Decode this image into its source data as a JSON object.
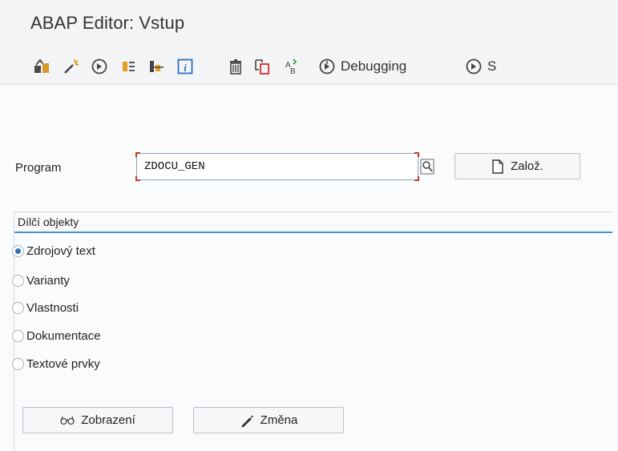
{
  "window": {
    "title": "ABAP Editor: Vstup"
  },
  "toolbar": {
    "icons": [
      "object-list-icon",
      "magic-wand-icon",
      "execute-icon",
      "where-used-icon",
      "hierarchy-icon",
      "info-icon",
      "delete-icon",
      "copy-icon",
      "rename-icon"
    ],
    "debugging_label": "Debugging",
    "truncated_label": "S"
  },
  "program": {
    "label": "Program",
    "value": "ZDOCU_GEN",
    "create_label": "Založ."
  },
  "subobjects": {
    "title": "Dílčí objekty",
    "options": [
      {
        "label": "Zdrojový text",
        "selected": true
      },
      {
        "label": "Varianty",
        "selected": false
      },
      {
        "label": "Vlastnosti",
        "selected": false
      },
      {
        "label": "Dokumentace",
        "selected": false
      },
      {
        "label": "Textové prvky",
        "selected": false
      }
    ]
  },
  "actions": {
    "display_label": "Zobrazení",
    "change_label": "Změna"
  },
  "colors": {
    "accent": "#2e6fbd",
    "focus_corner": "#c0392b",
    "group_line": "#4d8fcb"
  }
}
